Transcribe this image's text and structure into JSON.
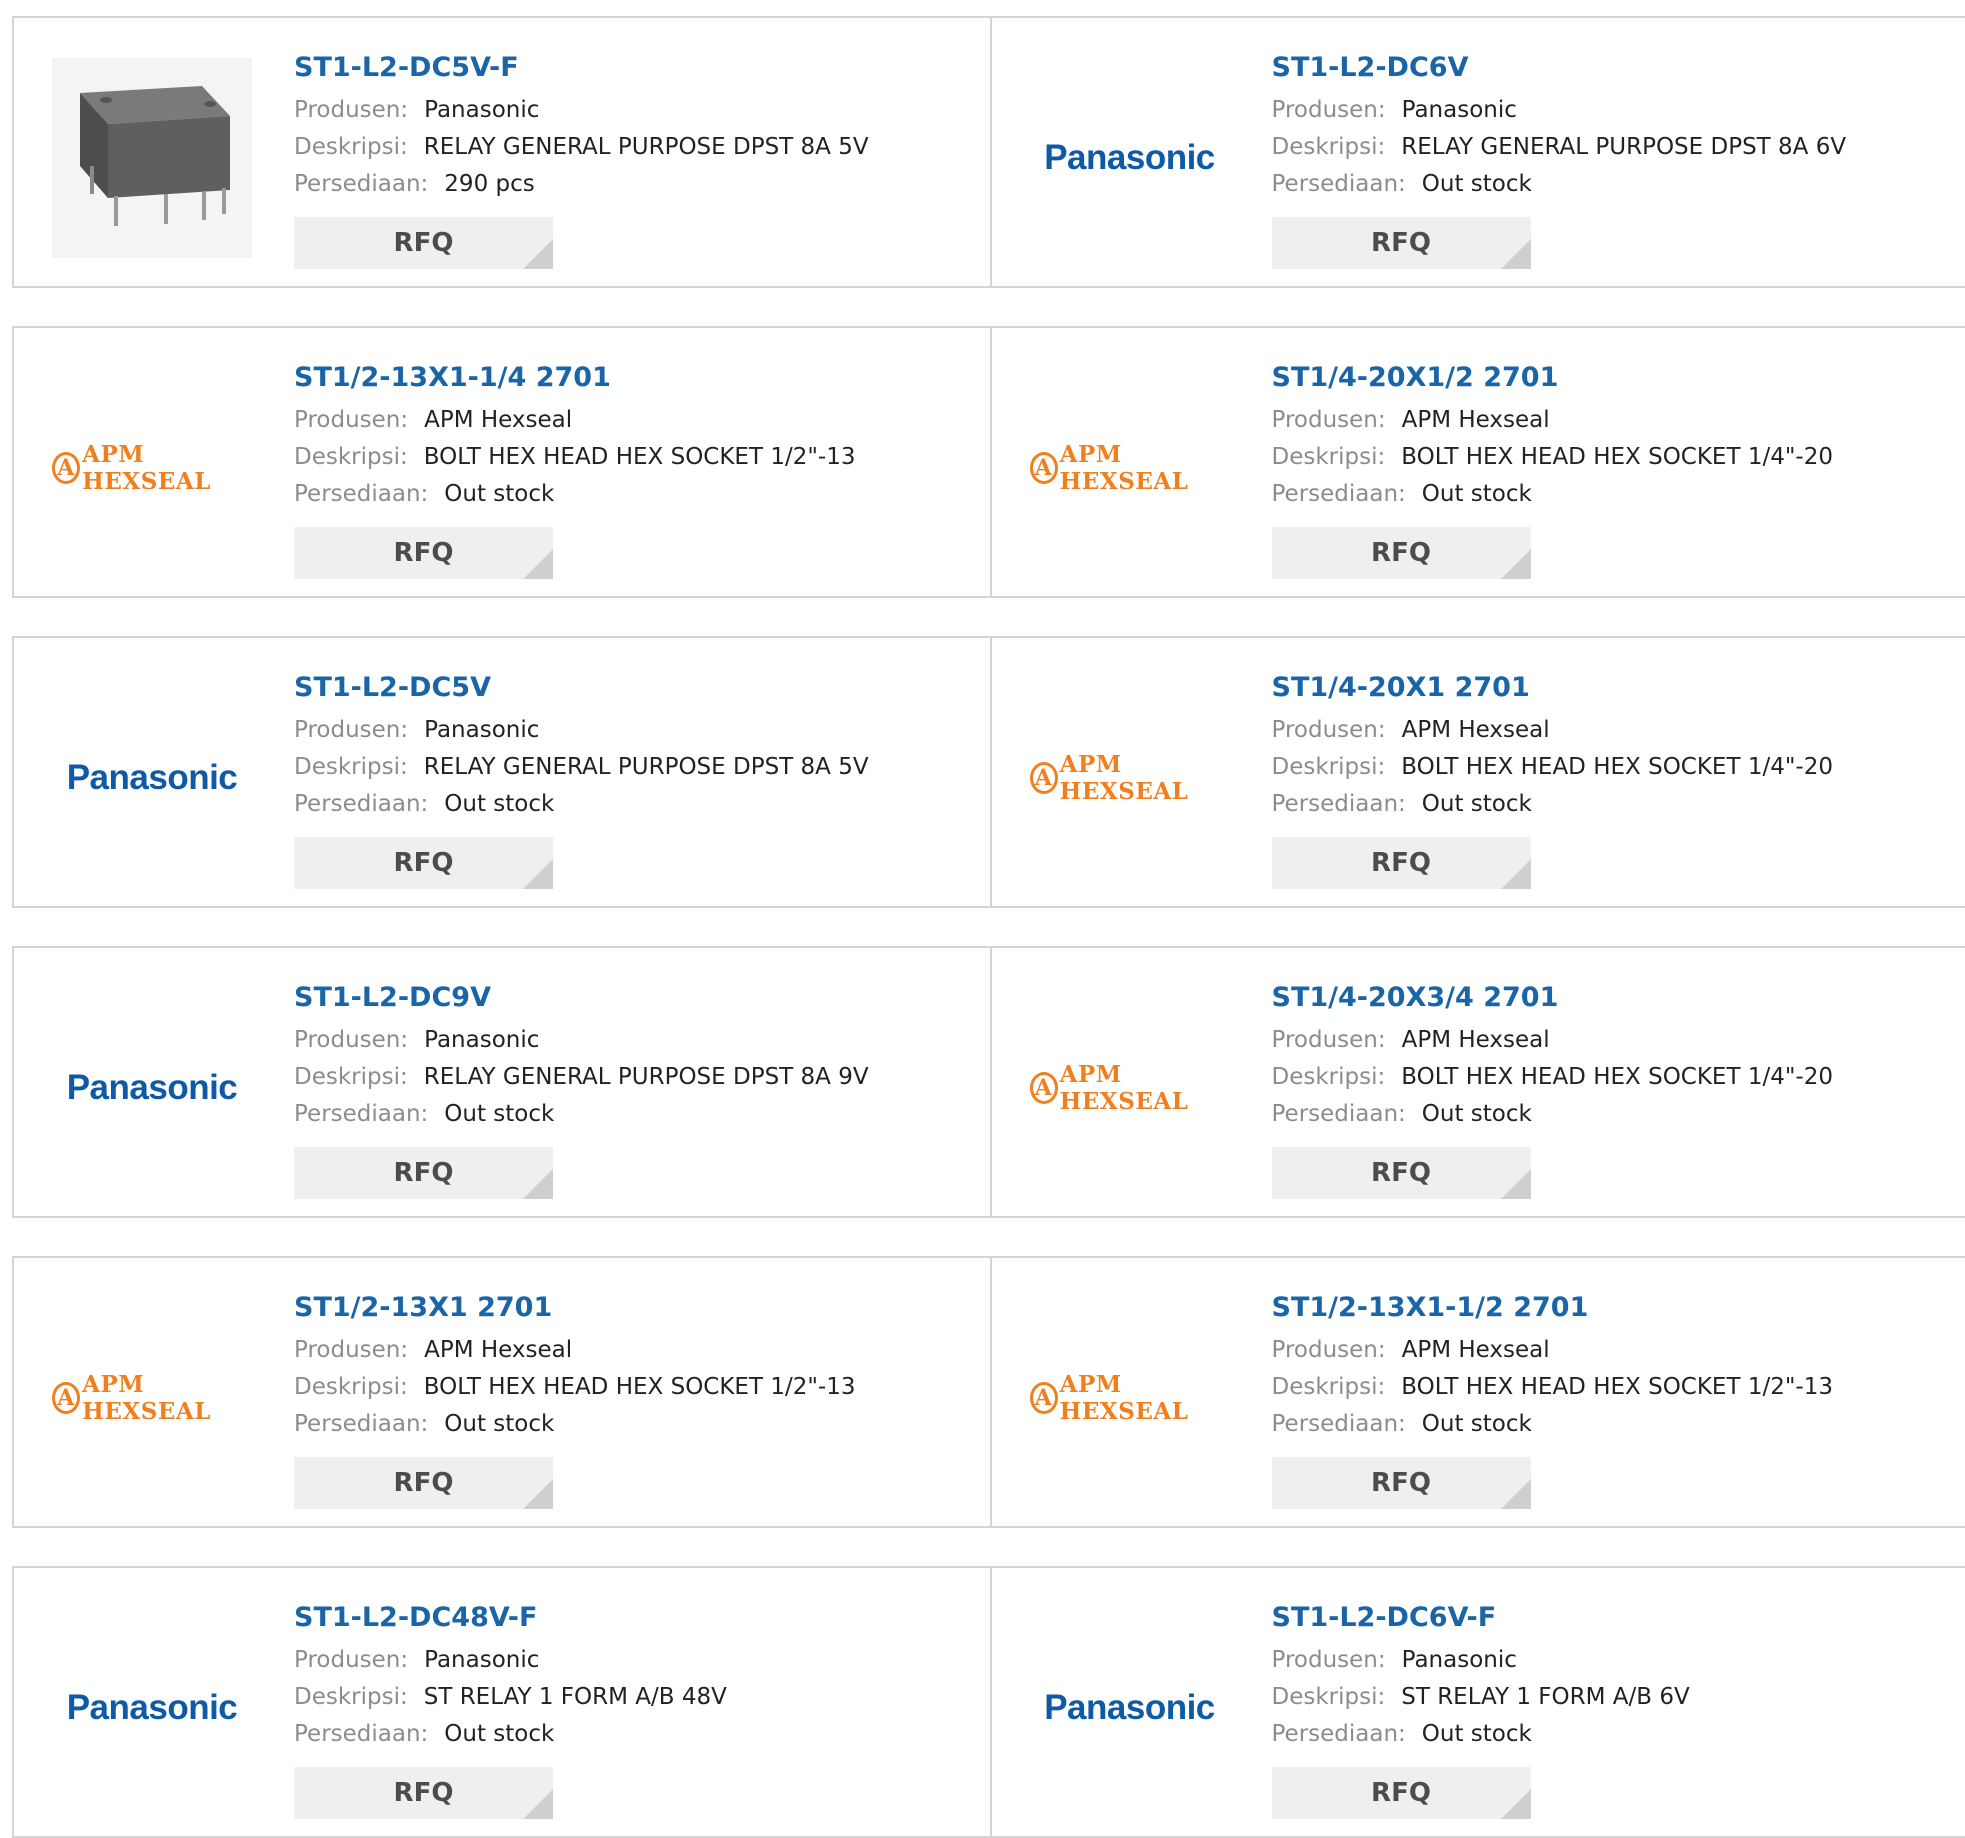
{
  "labels": {
    "manufacturer": "Produsen:",
    "description": "Deskripsi:",
    "stock": "Persediaan:",
    "rfq": "RFQ"
  },
  "logos": {
    "panasonic": "Panasonic",
    "apm_hexseal": "APM HEXSEAL"
  },
  "colors": {
    "title": "#1a64a8",
    "panasonic_logo": "#0f5aa6",
    "apm_logo": "#f07f1e",
    "rfq_bg": "#efefef"
  },
  "products": [
    {
      "part": "ST1-L2-DC5V-F",
      "manufacturer": "Panasonic",
      "description": "RELAY GENERAL PURPOSE DPST 8A 5V",
      "stock": "290 pcs",
      "image": "relay-photo"
    },
    {
      "part": "ST1-L2-DC6V",
      "manufacturer": "Panasonic",
      "description": "RELAY GENERAL PURPOSE DPST 8A 6V",
      "stock": "Out stock",
      "image": "panasonic-logo"
    },
    {
      "part": "ST1/2-13X1-1/4 2701",
      "manufacturer": "APM Hexseal",
      "description": "BOLT HEX HEAD HEX SOCKET 1/2\"-13",
      "stock": "Out stock",
      "image": "apm-hexseal-logo"
    },
    {
      "part": "ST1/4-20X1/2 2701",
      "manufacturer": "APM Hexseal",
      "description": "BOLT HEX HEAD HEX SOCKET 1/4\"-20",
      "stock": "Out stock",
      "image": "apm-hexseal-logo"
    },
    {
      "part": "ST1-L2-DC5V",
      "manufacturer": "Panasonic",
      "description": "RELAY GENERAL PURPOSE DPST 8A 5V",
      "stock": "Out stock",
      "image": "panasonic-logo"
    },
    {
      "part": "ST1/4-20X1 2701",
      "manufacturer": "APM Hexseal",
      "description": "BOLT HEX HEAD HEX SOCKET 1/4\"-20",
      "stock": "Out stock",
      "image": "apm-hexseal-logo"
    },
    {
      "part": "ST1-L2-DC9V",
      "manufacturer": "Panasonic",
      "description": "RELAY GENERAL PURPOSE DPST 8A 9V",
      "stock": "Out stock",
      "image": "panasonic-logo"
    },
    {
      "part": "ST1/4-20X3/4 2701",
      "manufacturer": "APM Hexseal",
      "description": "BOLT HEX HEAD HEX SOCKET 1/4\"-20",
      "stock": "Out stock",
      "image": "apm-hexseal-logo"
    },
    {
      "part": "ST1/2-13X1 2701",
      "manufacturer": "APM Hexseal",
      "description": "BOLT HEX HEAD HEX SOCKET 1/2\"-13",
      "stock": "Out stock",
      "image": "apm-hexseal-logo"
    },
    {
      "part": "ST1/2-13X1-1/2 2701",
      "manufacturer": "APM Hexseal",
      "description": "BOLT HEX HEAD HEX SOCKET 1/2\"-13",
      "stock": "Out stock",
      "image": "apm-hexseal-logo"
    },
    {
      "part": "ST1-L2-DC48V-F",
      "manufacturer": "Panasonic",
      "description": "ST RELAY 1 FORM A/B 48V",
      "stock": "Out stock",
      "image": "panasonic-logo"
    },
    {
      "part": "ST1-L2-DC6V-F",
      "manufacturer": "Panasonic",
      "description": "ST RELAY 1 FORM A/B 6V",
      "stock": "Out stock",
      "image": "panasonic-logo"
    }
  ]
}
